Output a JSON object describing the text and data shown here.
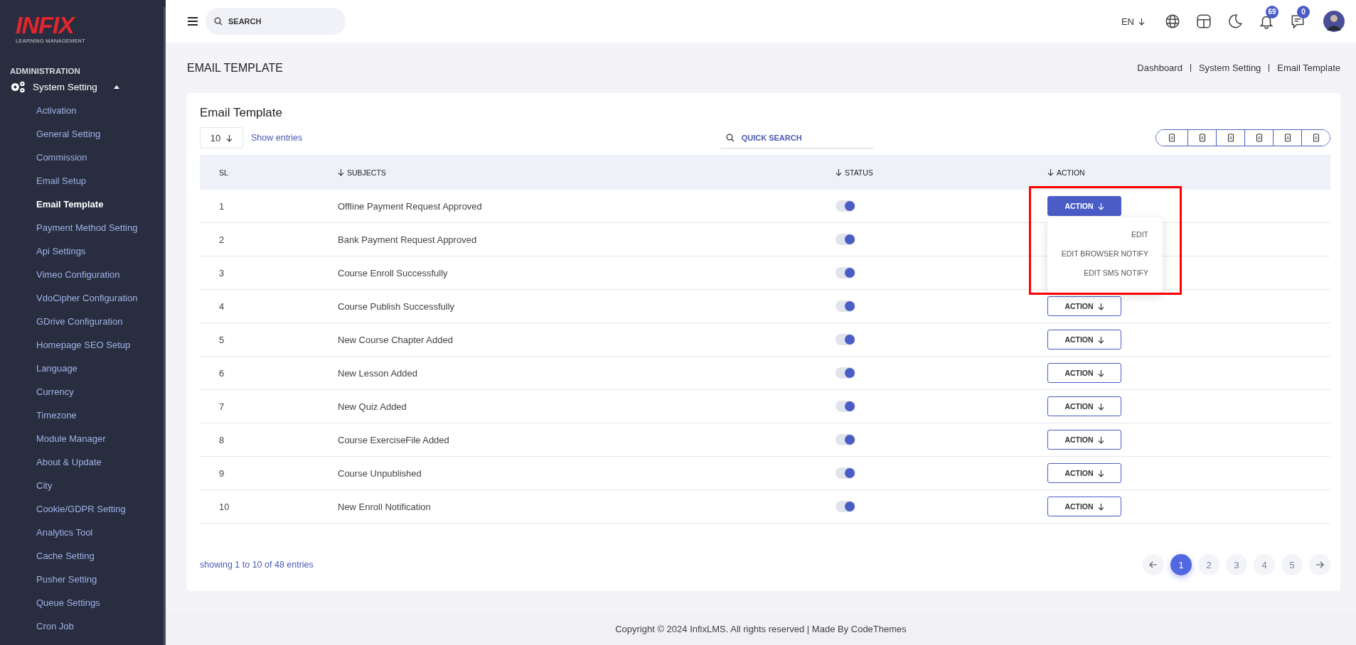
{
  "sidebar": {
    "logo": {
      "brand": "INFIX",
      "tagline": "LEARNING MANAGEMENT"
    },
    "section": "ADMINISTRATION",
    "group": {
      "label": "System Setting",
      "expanded": true,
      "children": [
        {
          "label": "Activation",
          "selected": false
        },
        {
          "label": "General Setting",
          "selected": false
        },
        {
          "label": "Commission",
          "selected": false
        },
        {
          "label": "Email Setup",
          "selected": false
        },
        {
          "label": "Email Template",
          "selected": true
        },
        {
          "label": "Payment Method Setting",
          "selected": false
        },
        {
          "label": "Api Settings",
          "selected": false
        },
        {
          "label": "Vimeo Configuration",
          "selected": false
        },
        {
          "label": "VdoCipher Configuration",
          "selected": false
        },
        {
          "label": "GDrive Configuration",
          "selected": false
        },
        {
          "label": "Homepage SEO Setup",
          "selected": false
        },
        {
          "label": "Language",
          "selected": false
        },
        {
          "label": "Currency",
          "selected": false
        },
        {
          "label": "Timezone",
          "selected": false
        },
        {
          "label": "Module Manager",
          "selected": false
        },
        {
          "label": "About & Update",
          "selected": false
        },
        {
          "label": "City",
          "selected": false
        },
        {
          "label": "Cookie/GDPR Setting",
          "selected": false
        },
        {
          "label": "Analytics Tool",
          "selected": false
        },
        {
          "label": "Cache Setting",
          "selected": false
        },
        {
          "label": "Pusher Setting",
          "selected": false
        },
        {
          "label": "Queue Settings",
          "selected": false
        },
        {
          "label": "Cron Job",
          "selected": false
        }
      ]
    }
  },
  "topbar": {
    "search": {
      "placeholder": "SEARCH"
    },
    "language": "EN",
    "notifications": {
      "count": "69"
    },
    "messages": {
      "count": "0"
    }
  },
  "page": {
    "title": "EMAIL TEMPLATE",
    "breadcrumb": [
      "Dashboard",
      "System Setting",
      "Email Template"
    ]
  },
  "card": {
    "title": "Email Template",
    "page_size": "10",
    "show_entries": "Show entries",
    "quick_search": {
      "placeholder": "QUICK SEARCH"
    },
    "columns": [
      {
        "label": "SL",
        "sortable": false
      },
      {
        "label": "SUBJECTS",
        "sortable": true
      },
      {
        "label": "STATUS",
        "sortable": true
      },
      {
        "label": "ACTION",
        "sortable": true
      }
    ],
    "rows": [
      {
        "sl": "1",
        "subject": "Offline Payment Request Approved",
        "status_on": true,
        "action": "ACTION",
        "menu_open": true,
        "highlighted": true
      },
      {
        "sl": "2",
        "subject": "Bank Payment Request Approved",
        "status_on": true,
        "menu_open": false,
        "highlighted": false
      },
      {
        "sl": "3",
        "subject": "Course Enroll Successfully",
        "status_on": true,
        "menu_open": false,
        "highlighted": false
      },
      {
        "sl": "4",
        "subject": "Course Publish Successfully",
        "status_on": true,
        "action": "ACTION",
        "menu_open": false,
        "highlighted": false
      },
      {
        "sl": "5",
        "subject": "New Course Chapter Added",
        "status_on": true,
        "action": "ACTION",
        "menu_open": false,
        "highlighted": false
      },
      {
        "sl": "6",
        "subject": "New Lesson Added",
        "status_on": true,
        "action": "ACTION",
        "menu_open": false,
        "highlighted": false
      },
      {
        "sl": "7",
        "subject": "New Quiz Added",
        "status_on": true,
        "action": "ACTION",
        "menu_open": false,
        "highlighted": false
      },
      {
        "sl": "8",
        "subject": "Course ExerciseFile Added",
        "status_on": true,
        "action": "ACTION",
        "menu_open": false,
        "highlighted": false
      },
      {
        "sl": "9",
        "subject": "Course Unpublished",
        "status_on": true,
        "action": "ACTION",
        "menu_open": false,
        "highlighted": false
      },
      {
        "sl": "10",
        "subject": "New Enroll Notification",
        "status_on": true,
        "action": "ACTION",
        "menu_open": false,
        "highlighted": false
      }
    ],
    "menu_items": [
      "EDIT",
      "EDIT BROWSER NOTIFY",
      "EDIT SMS NOTIFY"
    ],
    "summary": "showing 1 to 10 of 48 entries",
    "pages": [
      {
        "label": "1",
        "selected": true
      },
      {
        "label": "2",
        "selected": false
      },
      {
        "label": "3",
        "selected": false
      },
      {
        "label": "4",
        "selected": false
      },
      {
        "label": "5",
        "selected": false
      }
    ]
  },
  "footer": "Copyright © 2024 InfixLMS. All rights reserved | Made By CodeThemes"
}
